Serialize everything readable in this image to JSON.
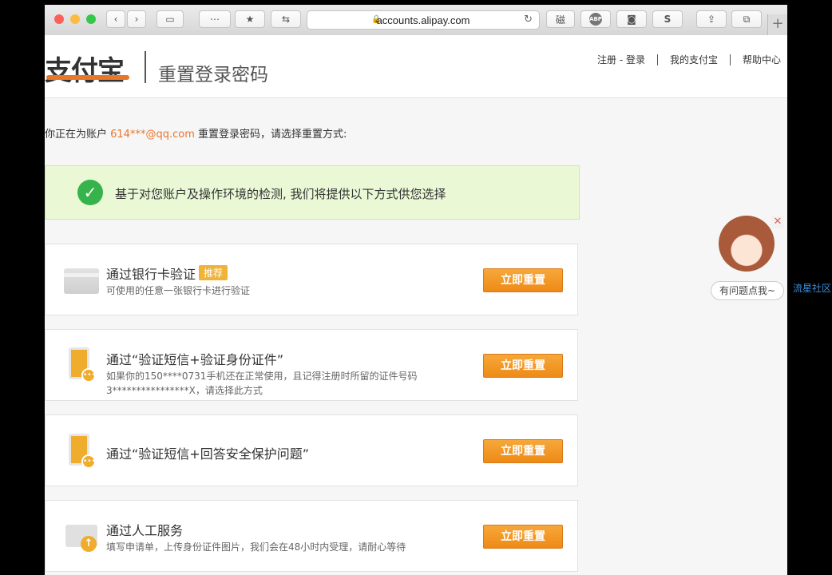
{
  "browser": {
    "url": "accounts.alipay.com",
    "buttons": [
      "ABP",
      "S"
    ]
  },
  "header": {
    "logo": "支付宝",
    "title": "重置登录密码",
    "nav": [
      "注册 - 登录",
      "我的支付宝",
      "帮助中心"
    ]
  },
  "account": {
    "prefix": "你正在为账户 ",
    "email": "614***@qq.com",
    "suffix": " 重置登录密码，请选择重置方式:"
  },
  "notice": "基于对您账户及操作环境的检测, 我们将提供以下方式供您选择",
  "options": [
    {
      "title": "通过银行卡验证",
      "tag": "推荐",
      "desc": "可使用的任意一张银行卡进行验证",
      "button": "立即重置"
    },
    {
      "title": "通过“验证短信+验证身份证件”",
      "desc": "如果你的150****0731手机还在正常使用，且记得注册时所留的证件号码3****************X，请选择此方式",
      "button": "立即重置"
    },
    {
      "title": "通过“验证短信+回答安全保护问题”",
      "desc": "",
      "button": "立即重置"
    },
    {
      "title": "通过人工服务",
      "desc": "填写申请单，上传身份证件图片，我们会在48小时内受理，请耐心等待",
      "button": "立即重置"
    }
  ],
  "help_widget": {
    "label": "有问题点我~"
  },
  "side_link": "流星社区",
  "colors": {
    "accent": "#e8762b",
    "button": "#f0a02a",
    "notice_bg": "#eaf8d6"
  }
}
